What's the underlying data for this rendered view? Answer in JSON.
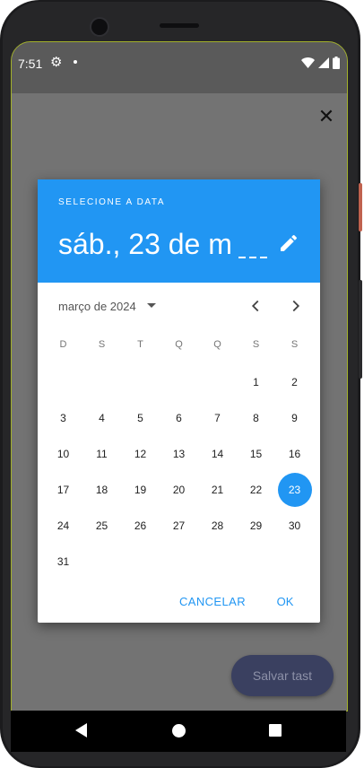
{
  "status_bar": {
    "time": "7:51"
  },
  "dialog": {
    "header_label": "SELECIONE A DATA",
    "selected_date": "sáb., 23 de m",
    "month_label": "março de 2024",
    "weekdays": [
      "D",
      "S",
      "T",
      "Q",
      "Q",
      "S",
      "S"
    ],
    "leading_blank_days": 5,
    "days_in_month": 31,
    "selected_day": 23,
    "cancel_label": "CANCELAR",
    "ok_label": "OK"
  },
  "fab": {
    "label": "Salvar tast"
  },
  "colors": {
    "accent": "#2196f3",
    "scrim": "#737373",
    "fab": "#3a4060"
  },
  "icons": [
    "gear-icon",
    "wifi-icon",
    "signal-icon",
    "battery-icon",
    "close-icon",
    "edit-icon",
    "dropdown-arrow-icon",
    "chevron-left-icon",
    "chevron-right-icon",
    "back-icon",
    "home-icon",
    "recents-icon"
  ]
}
